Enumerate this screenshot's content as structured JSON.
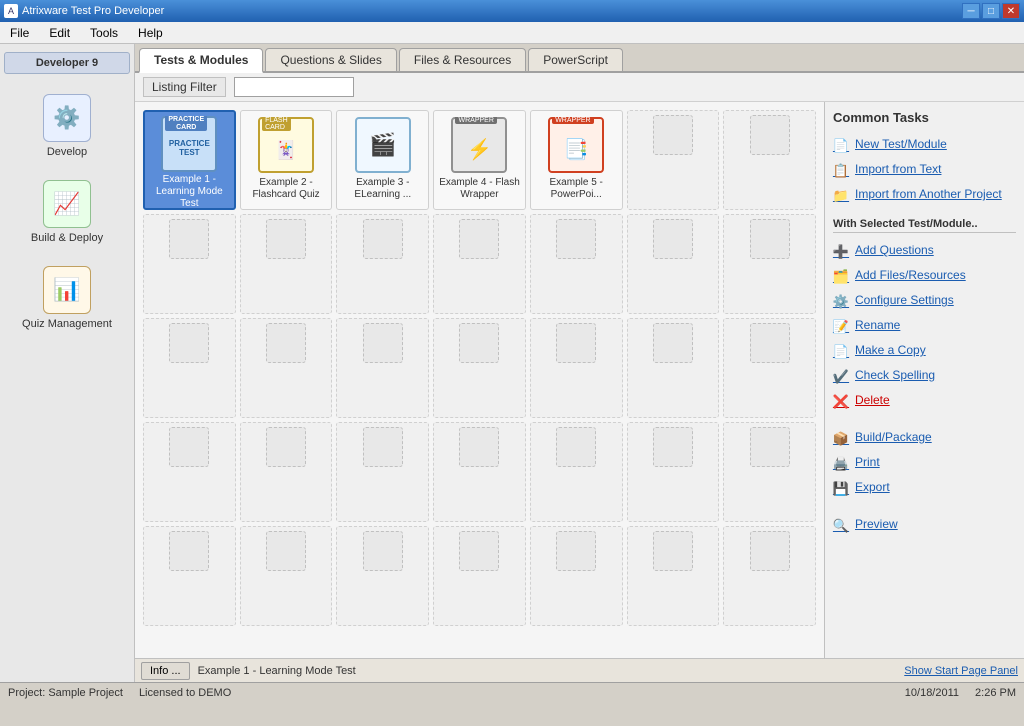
{
  "titlebar": {
    "title": "Atrixware Test Pro Developer",
    "icon": "A",
    "min_btn": "─",
    "max_btn": "□",
    "close_btn": "✕"
  },
  "menubar": {
    "items": [
      "File",
      "Edit",
      "Tools",
      "Help"
    ]
  },
  "sidebar": {
    "label": "Developer 9",
    "items": [
      {
        "id": "develop",
        "label": "Develop",
        "icon": "⚙"
      },
      {
        "id": "build-deploy",
        "label": "Build & Deploy",
        "icon": "📈"
      },
      {
        "id": "quiz-management",
        "label": "Quiz Management",
        "icon": "📊"
      }
    ]
  },
  "tabs": [
    {
      "id": "tests-modules",
      "label": "Tests & Modules",
      "active": true
    },
    {
      "id": "questions-slides",
      "label": "Questions & Slides",
      "active": false
    },
    {
      "id": "files-resources",
      "label": "Files & Resources",
      "active": false
    },
    {
      "id": "powerscript",
      "label": "PowerScript",
      "active": false
    }
  ],
  "filter": {
    "label": "Listing Filter",
    "placeholder": ""
  },
  "modules": [
    {
      "id": 1,
      "label": "Example 1 -\nLearning Mode Test",
      "type": "practice",
      "selected": true,
      "tag": "PRACTICE CARD"
    },
    {
      "id": 2,
      "label": "Example 2 -\nFlashcard Quiz",
      "type": "flashcard",
      "selected": false,
      "tag": "FLASH CARD"
    },
    {
      "id": 3,
      "label": "Example 3 -\nELearning ...",
      "type": "elearning",
      "selected": false,
      "tag": ""
    },
    {
      "id": 4,
      "label": "Example 4 - Flash\nWrapper",
      "type": "flash-wrapper",
      "selected": false,
      "tag": "WRAPPER"
    },
    {
      "id": 5,
      "label": "Example 5 -\nPowerPoi...",
      "type": "ppt-wrapper",
      "selected": false,
      "tag": "WRAPPER"
    },
    {
      "id": 6,
      "label": "",
      "type": "empty"
    },
    {
      "id": 7,
      "label": "",
      "type": "empty"
    },
    {
      "id": 8,
      "label": "",
      "type": "empty"
    },
    {
      "id": 9,
      "label": "",
      "type": "empty"
    },
    {
      "id": 10,
      "label": "",
      "type": "empty"
    },
    {
      "id": 11,
      "label": "",
      "type": "empty"
    },
    {
      "id": 12,
      "label": "",
      "type": "empty"
    },
    {
      "id": 13,
      "label": "",
      "type": "empty"
    },
    {
      "id": 14,
      "label": "",
      "type": "empty"
    },
    {
      "id": 15,
      "label": "",
      "type": "empty"
    },
    {
      "id": 16,
      "label": "",
      "type": "empty"
    },
    {
      "id": 17,
      "label": "",
      "type": "empty"
    },
    {
      "id": 18,
      "label": "",
      "type": "empty"
    },
    {
      "id": 19,
      "label": "",
      "type": "empty"
    },
    {
      "id": 20,
      "label": "",
      "type": "empty"
    },
    {
      "id": 21,
      "label": "",
      "type": "empty"
    },
    {
      "id": 22,
      "label": "",
      "type": "empty"
    },
    {
      "id": 23,
      "label": "",
      "type": "empty"
    },
    {
      "id": 24,
      "label": "",
      "type": "empty"
    },
    {
      "id": 25,
      "label": "",
      "type": "empty"
    },
    {
      "id": 26,
      "label": "",
      "type": "empty"
    },
    {
      "id": 27,
      "label": "",
      "type": "empty"
    },
    {
      "id": 28,
      "label": "",
      "type": "empty"
    },
    {
      "id": 29,
      "label": "",
      "type": "empty"
    },
    {
      "id": 30,
      "label": "",
      "type": "empty"
    },
    {
      "id": 31,
      "label": "",
      "type": "empty"
    },
    {
      "id": 32,
      "label": "",
      "type": "empty"
    },
    {
      "id": 33,
      "label": "",
      "type": "empty"
    },
    {
      "id": 34,
      "label": "",
      "type": "empty"
    },
    {
      "id": 35,
      "label": "",
      "type": "empty"
    }
  ],
  "right_panel": {
    "common_tasks_title": "Common Tasks",
    "new_test": "New Test/Module",
    "import_text": "Import from Text",
    "import_project": "Import from Another Project",
    "selected_section": "With Selected Test/Module..",
    "add_questions": "Add Questions",
    "add_files": "Add Files/Resources",
    "configure": "Configure Settings",
    "rename": "Rename",
    "make_copy": "Make a Copy",
    "check_spelling": "Check Spelling",
    "delete": "Delete",
    "build_package": "Build/Package",
    "print": "Print",
    "export": "Export",
    "preview": "Preview"
  },
  "infobar": {
    "info_btn": "Info ...",
    "selected_item": "Example 1 - Learning Mode Test",
    "show_start": "Show Start Page Panel"
  },
  "statusbar": {
    "project": "Project: Sample Project",
    "license": "Licensed to DEMO",
    "date": "10/18/2011",
    "time": "2:26 PM"
  }
}
